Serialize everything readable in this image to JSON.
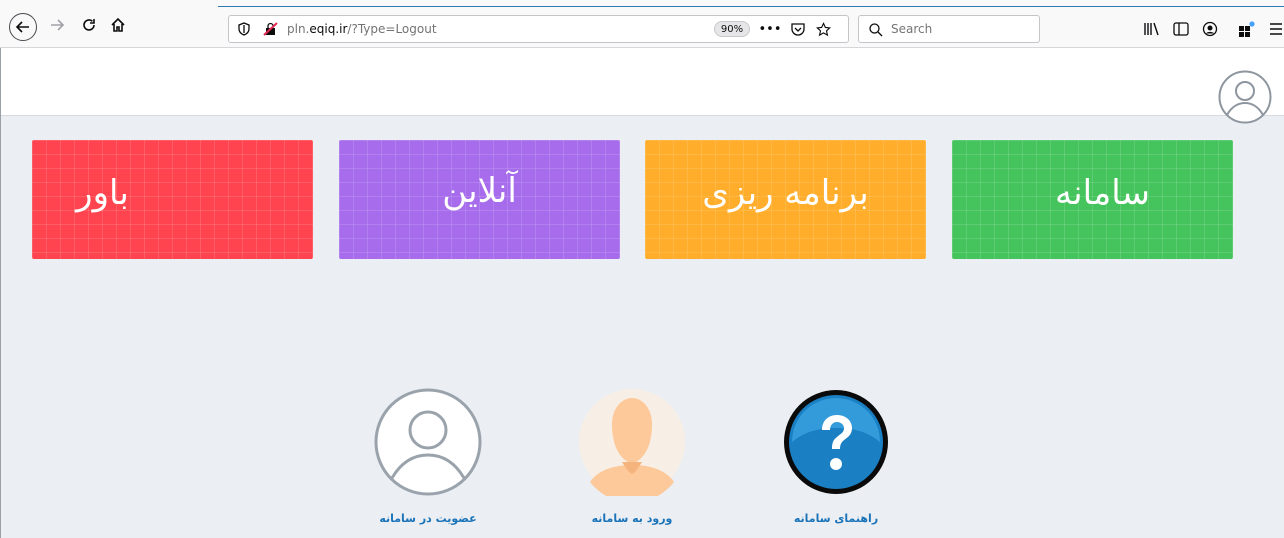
{
  "browser": {
    "url_prefix": "pln.",
    "url_domain": "eqiq.ir",
    "url_suffix": "/?Type=Logout",
    "zoom": "90%",
    "search_placeholder": "Search"
  },
  "tiles": {
    "bavar": "باور",
    "online": "آنلاین",
    "barnameh": "برنامه ریزی",
    "samaneh": "سامانه"
  },
  "links": {
    "join": "عضویت در سامانه",
    "login": "ورود به سامانه",
    "guide": "راهنمای سامانه"
  },
  "colors": {
    "red": "#ff444f",
    "purple": "#a66ceb",
    "orange": "#ffad2b",
    "green": "#45c35c",
    "link": "#1a73b8"
  }
}
